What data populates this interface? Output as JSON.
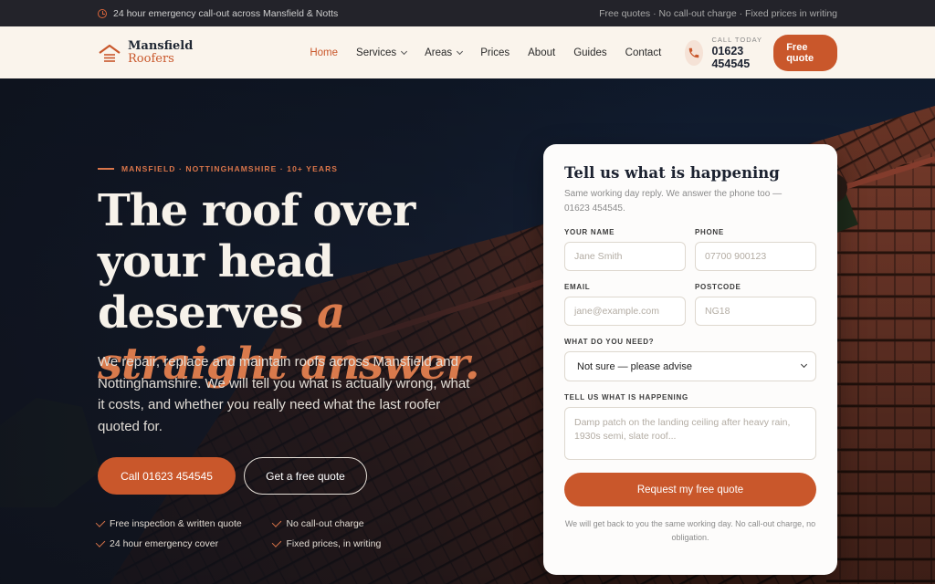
{
  "topbar": {
    "emergency_text": "24 hour emergency call-out across Mansfield & Notts",
    "usp_text": "Free quotes · No call-out charge · Fixed prices in writing"
  },
  "header": {
    "logo_line1": "Mansfield",
    "logo_line2": "Roofers",
    "nav": [
      {
        "label": "Home"
      },
      {
        "label": "Services"
      },
      {
        "label": "Areas"
      },
      {
        "label": "Prices"
      },
      {
        "label": "About"
      },
      {
        "label": "Guides"
      },
      {
        "label": "Contact"
      }
    ],
    "call_label": "CALL TODAY",
    "call_number": "01623 454545",
    "quote_button": "Free quote"
  },
  "hero": {
    "eyebrow": "MANSFIELD · NOTTINGHAMSHIRE · 10+ YEARS",
    "headline_part1": "The roof over your head deserves",
    "headline_accent": "a straight answer.",
    "lead": "We repair, replace and maintain roofs across Mansfield and Nottinghamshire. We will tell you what is actually wrong, what it costs, and whether you really need what the last roofer quoted for.",
    "call_button": "Call 01623 454545",
    "quote_button": "Get a free quote",
    "checks": [
      "Free inspection & written quote",
      "No call-out charge",
      "24 hour emergency cover",
      "Fixed prices, in writing"
    ]
  },
  "form": {
    "title": "Tell us what is happening",
    "subtitle": "Same working day reply. We answer the phone too — 01623 454545.",
    "name_label": "YOUR NAME",
    "name_placeholder": "Jane Smith",
    "phone_label": "PHONE",
    "phone_placeholder": "07700 900123",
    "email_label": "EMAIL",
    "email_placeholder": "jane@example.com",
    "postcode_label": "POSTCODE",
    "postcode_placeholder": "NG18",
    "need_label": "WHAT DO YOU NEED?",
    "need_value": "Not sure — please advise",
    "details_label": "TELL US WHAT IS HAPPENING",
    "details_placeholder": "Damp patch on the landing ceiling after heavy rain, 1930s semi, slate roof...",
    "submit": "Request my free quote",
    "note": "We will get back to you the same working day. No call-out charge, no obligation."
  },
  "colors": {
    "accent": "#c9572b",
    "dark": "#1c2230",
    "cream": "#faf4ec"
  }
}
